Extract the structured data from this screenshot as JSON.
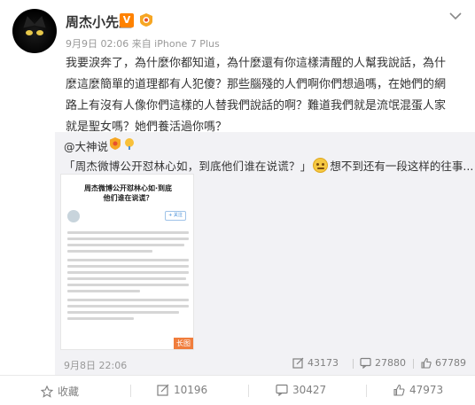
{
  "post": {
    "author": "周杰小先生",
    "verified_badge": "V",
    "meta": "9月9日 02:06 来自 iPhone 7 Plus",
    "content": "我要淚奔了，為什麼你都知道，為什麼還有你這樣清醒的人幫我說話，為什麼這麼簡單的道理都有人犯傻？那些腦殘的人們啊你們想過嗎，在她們的網路上有沒有人像你們這樣的人替我們說話的啊？難道我們就是流氓混蛋人家就是聖女嗎？她們養活過你嗎？"
  },
  "repost": {
    "author": "@大神说",
    "text_quote": "「周杰微博公开怼林心如，到底他们谁在说谎？」",
    "text_after": "想不到还有一段这样的往事...",
    "long_image": {
      "title": "周杰微博公开怼林心如·到底他们谁在说谎？",
      "follow": "+ 关注",
      "tag": "长图"
    },
    "time": "9月8日 22:06",
    "reposts": "43173",
    "comments": "27880",
    "likes": "67789"
  },
  "actions": {
    "favorite": "收藏",
    "repost": "10196",
    "comment": "30427",
    "like": "47973"
  },
  "colors": {
    "accent": "#ff8200",
    "muted": "#808080",
    "repost_bg": "#f2f2f5"
  }
}
